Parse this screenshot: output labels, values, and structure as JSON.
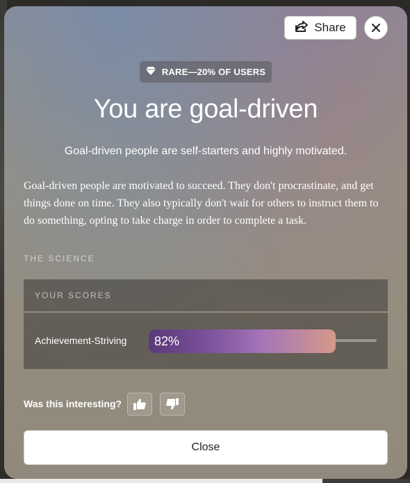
{
  "header": {
    "share_label": "Share",
    "share_icon": "share-icon",
    "close_icon": "close-icon"
  },
  "badge": {
    "icon": "diamond-icon",
    "label": "RARE—20% OF USERS"
  },
  "result": {
    "title": "You are goal-driven",
    "subtitle": "Goal-driven people are self-starters and highly motivated.",
    "description": "Goal-driven people are motivated to succeed. They don't procrastinate, and get things done on time. They also typically don't wait for others to instruct them to do something, opting to take charge in order to complete a task."
  },
  "science": {
    "section_label": "THE SCIENCE",
    "scores_header": "YOUR SCORES",
    "scores": [
      {
        "trait": "Achievement-Striving",
        "value_label": "82%",
        "value": 0.82
      }
    ]
  },
  "feedback": {
    "question": "Was this interesting?",
    "up_icon": "thumbs-up-icon",
    "down_icon": "thumbs-down-icon"
  },
  "footer": {
    "close_label": "Close"
  },
  "colors": {
    "bar_start": "#5a3a78",
    "bar_mid": "#a676b8",
    "bar_end": "#d59a88"
  }
}
